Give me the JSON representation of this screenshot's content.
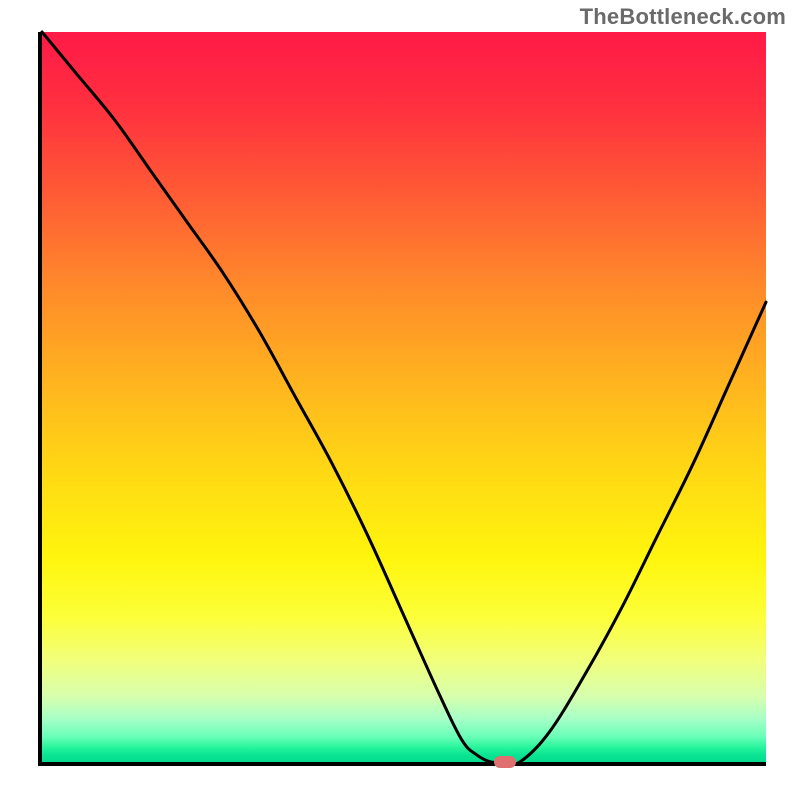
{
  "watermark": "TheBottleneck.com",
  "chart_data": {
    "type": "line",
    "title": "",
    "xlabel": "",
    "ylabel": "",
    "xlim": [
      0,
      100
    ],
    "ylim": [
      0,
      100
    ],
    "categories": [
      0,
      5,
      10,
      15,
      20,
      25,
      30,
      35,
      40,
      45,
      50,
      55,
      58,
      60,
      62,
      64,
      66,
      70,
      75,
      80,
      85,
      90,
      95,
      100
    ],
    "values": [
      100,
      94,
      88,
      81,
      74,
      67,
      59,
      50,
      41,
      31,
      20,
      9,
      3,
      1,
      0,
      0,
      0,
      4,
      12,
      21,
      31,
      41,
      52,
      63
    ],
    "marker": {
      "x": 64,
      "y": 0
    },
    "background": {
      "type": "vertical-gradient",
      "top_color": "#ff1a47",
      "mid_color": "#fff50d",
      "bottom_color": "#04da8e"
    },
    "grid": false,
    "legend": false
  }
}
